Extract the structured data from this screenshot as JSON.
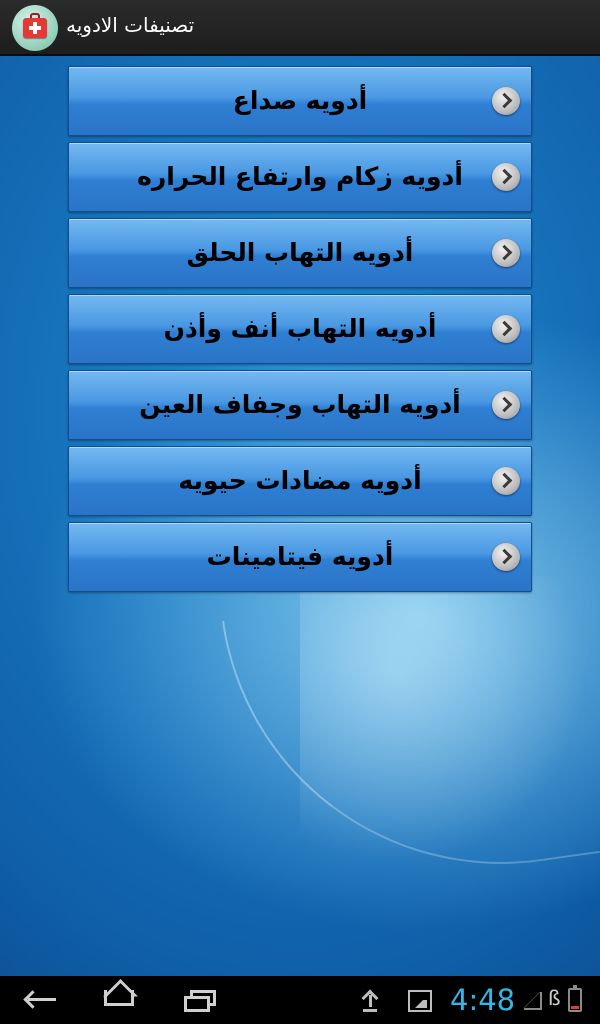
{
  "app": {
    "title": "تصنيفات الادويه",
    "icon": "first-aid-kit-icon"
  },
  "categories": [
    {
      "label": "أدويه صداع",
      "icon": "chevron-right-icon"
    },
    {
      "label": "أدويه زكام وارتفاع الحراره",
      "icon": "chevron-right-icon"
    },
    {
      "label": "أدويه التهاب الحلق",
      "icon": "chevron-right-icon"
    },
    {
      "label": "أدويه التهاب أنف وأذن",
      "icon": "chevron-right-icon"
    },
    {
      "label": "أدويه التهاب وجفاف العين",
      "icon": "chevron-right-icon"
    },
    {
      "label": "أدويه مضادات حيويه",
      "icon": "chevron-right-icon"
    },
    {
      "label": "أدويه فيتامينات",
      "icon": "chevron-right-icon"
    }
  ],
  "system_bar": {
    "time": "4:48",
    "icons": [
      "back-icon",
      "home-icon",
      "recent-apps-icon",
      "upload-icon",
      "gallery-icon",
      "signal-icon",
      "bluetooth-icon",
      "battery-icon"
    ],
    "battery": {
      "color": "#e53935",
      "level": 0.15
    },
    "clock_color": "#33b5e5"
  },
  "colors": {
    "button_top": "#74b9f0",
    "button_bottom": "#2a74c7",
    "background": "#0f5ea8"
  }
}
